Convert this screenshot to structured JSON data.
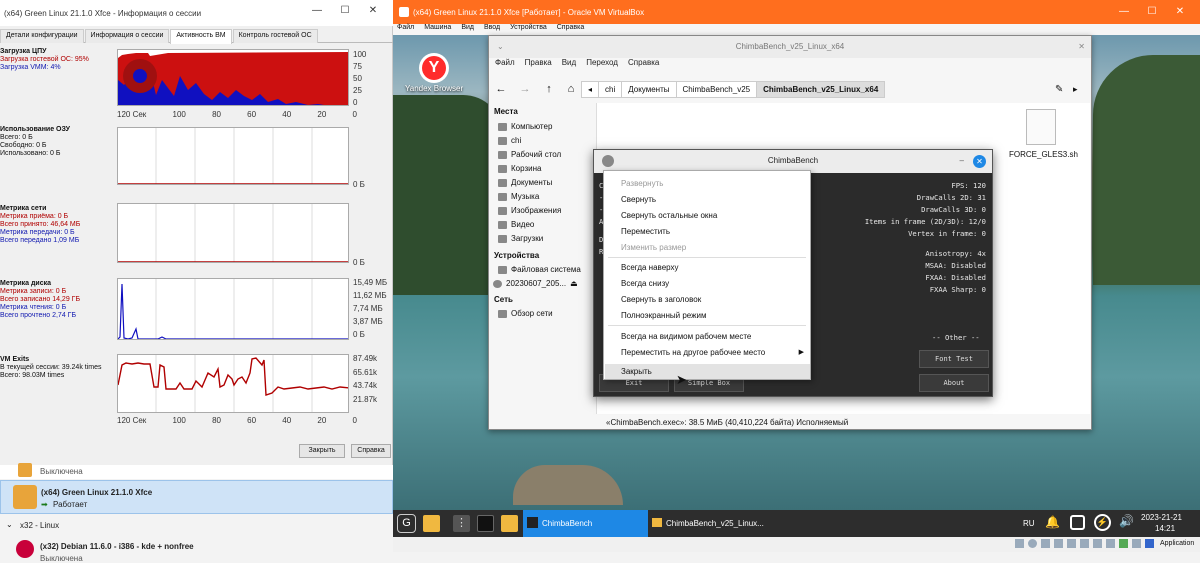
{
  "session_window": {
    "title": "(x64) Green Linux 21.1.0 Xfce - Информация о сессии",
    "tabs": [
      "Детали конфигурации",
      "Информация о сессии",
      "Активность ВМ",
      "Контроль гостевой ОС"
    ],
    "active_tab": "Активность ВМ",
    "sections": {
      "cpu": {
        "title": "Загрузка ЦПУ",
        "line1": "Загрузка гостевой ОС: 95%",
        "line2": "Загрузка VMM: 4%",
        "y_ticks": [
          "100",
          "75",
          "50",
          "25",
          "0"
        ]
      },
      "ram": {
        "title": "Использование ОЗУ",
        "lines": [
          "Всего: 0 Б",
          "Свободно: 0 Б",
          "Использовано: 0 Б"
        ],
        "y_ticks": [
          "0 Б"
        ]
      },
      "net": {
        "title": "Метрика сети",
        "lines": [
          "Метрика приёма: 0 Б",
          "Всего принято: 46,64 МБ",
          "Метрика передачи: 0 Б",
          "Всего передано 1,09 МБ"
        ],
        "y_ticks": [
          "0 Б"
        ]
      },
      "disk": {
        "title": "Метрика диска",
        "lines": [
          "Метрика записи: 0 Б",
          "Всего записано 14,29 ГБ",
          "Метрика чтения: 0 Б",
          "Всего прочтено 2,74 ГБ"
        ],
        "y_ticks": [
          "15,49 МБ",
          "11,62 МБ",
          "7,74 МБ",
          "3,87 МБ",
          "0 Б"
        ]
      },
      "exits": {
        "title": "VM Exits",
        "lines": [
          "В текущей сессии: 39.24k times",
          "Всего: 98.03M times"
        ],
        "y_ticks": [
          "87.49k",
          "65.61k",
          "43.74k",
          "21.87k"
        ]
      }
    },
    "x_ticks": [
      "120 Сек",
      "100",
      "80",
      "60",
      "40",
      "20",
      "0"
    ],
    "close_button": "Закрыть",
    "help_button": "Справка"
  },
  "vm_list": {
    "item0_status": "Выключена",
    "item1_name": "(x64) Green Linux 21.1.0 Xfce",
    "item1_status": "Работает",
    "group": "x32 - Linux",
    "item2_name": "(x32) Debian 11.6.0 - i386 - kde + nonfree",
    "item2_status": "Выключена"
  },
  "vbox_window": {
    "title": "(x64) Green Linux 21.1.0 Xfce [Работает] - Oracle VM VirtualBox",
    "menu": [
      "Файл",
      "Машина",
      "Вид",
      "Ввод",
      "Устройства",
      "Справка"
    ],
    "desktop_icon": "Yandex Browser",
    "status_right": "Application"
  },
  "file_manager": {
    "title": "ChimbaBench_v25_Linux_x64",
    "menu": [
      "Файл",
      "Правка",
      "Вид",
      "Переход",
      "Справка"
    ],
    "crumbs": [
      "chi",
      "Документы",
      "ChimbaBench_v25",
      "ChimbaBench_v25_Linux_x64"
    ],
    "places_header": "Места",
    "places": [
      "Компьютер",
      "chi",
      "Рабочий стол",
      "Корзина",
      "Документы",
      "Музыка",
      "Изображения",
      "Видео",
      "Загрузки"
    ],
    "devices_header": "Устройства",
    "devices": [
      "Файловая система",
      "20230607_205..."
    ],
    "network_header": "Сеть",
    "network": [
      "Обзор сети"
    ],
    "file_name": "FORCE_GLES3.sh",
    "status": "«ChimbaBench.exec»: 38.5 МиБ (40,410,224 байта) Исполняемый"
  },
  "chimba": {
    "title": "ChimbaBench",
    "left_frag": [
      "Ch",
      "-",
      "-",
      "AP",
      "De",
      "Re"
    ],
    "stats": [
      "FPS: 120",
      "DrawCalls 2D: 31",
      "DrawCalls 3D: 0",
      "Items in frame (2D/3D): 12/0",
      "Vertex in frame: 0",
      "Anisotropy: 4x",
      "MSAA: Disabled",
      "FXAA: Disabled",
      "FXAA Sharp: 0"
    ],
    "other": "-- Other --",
    "font_test": "Font Test",
    "about": "About",
    "exit": "Exit",
    "simple_box": "Simple Box"
  },
  "context_menu": {
    "items": [
      "Развернуть",
      "Свернуть",
      "Свернуть остальные окна",
      "Переместить",
      "Изменить размер",
      "Всегда наверху",
      "Всегда снизу",
      "Свернуть в заголовок",
      "Полноэкранный режим",
      "Всегда на видимом рабочем месте",
      "Переместить на другое рабочее место",
      "Закрыть"
    ]
  },
  "taskbar": {
    "task1": "ChimbaBench",
    "task2": "ChimbaBench_v25_Linux...",
    "lang": "RU",
    "date": "2023-21-21",
    "time": "14:21"
  },
  "colors": {
    "vbox_titlebar": "#ff6e1e",
    "cpu_guest": "#cc1010",
    "cpu_vmm": "#1010c0",
    "task_active": "#1e88e5"
  }
}
